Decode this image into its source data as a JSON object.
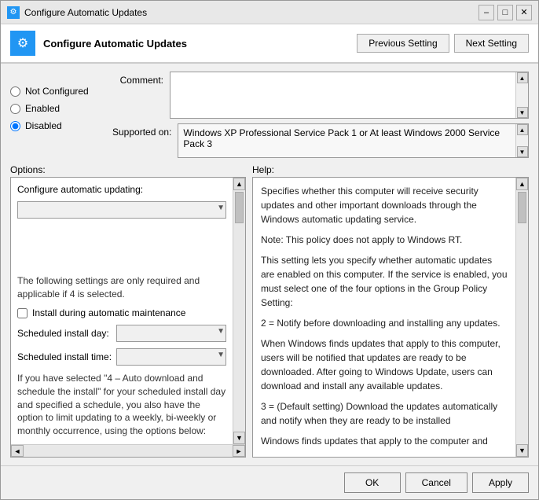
{
  "window": {
    "title": "Configure Automatic Updates",
    "icon": "⚙"
  },
  "header": {
    "title": "Configure Automatic Updates",
    "icon": "⚙",
    "prev_button": "Previous Setting",
    "next_button": "Next Setting"
  },
  "radio_group": {
    "not_configured_label": "Not Configured",
    "enabled_label": "Enabled",
    "disabled_label": "Disabled",
    "selected": "disabled"
  },
  "fields": {
    "comment_label": "Comment:",
    "supported_label": "Supported on:",
    "supported_value": "Windows XP Professional Service Pack 1 or At least Windows 2000 Service Pack 3"
  },
  "sections": {
    "options_title": "Options:",
    "help_title": "Help:"
  },
  "options": {
    "configure_label": "Configure automatic updating:",
    "dropdown_placeholder": "",
    "checkbox_label": "Install during automatic maintenance",
    "schedule_day_label": "Scheduled install day:",
    "schedule_time_label": "Scheduled install time:",
    "paragraph": "The following settings are only required and applicable if 4 is selected.",
    "bottom_paragraph": "If you have selected \"4 – Auto download and schedule the install\" for your scheduled install day and specified a schedule, you also have the option to limit updating to a weekly, bi-weekly or monthly occurrence, using the options below:"
  },
  "help": {
    "p1": "Specifies whether this computer will receive security updates and other important downloads through the Windows automatic updating service.",
    "p2": "Note: This policy does not apply to Windows RT.",
    "p3": "This setting lets you specify whether automatic updates are enabled on this computer. If the service is enabled, you must select one of the four options in the Group Policy Setting:",
    "p4": "2 = Notify before downloading and installing any updates.",
    "p5": "When Windows finds updates that apply to this computer, users will be notified that updates are ready to be downloaded. After going to Windows Update, users can download and install any available updates.",
    "p6": "3 = (Default setting) Download the updates automatically and notify when they are ready to be installed",
    "p7": "Windows finds updates that apply to the computer and"
  },
  "buttons": {
    "ok": "OK",
    "cancel": "Cancel",
    "apply": "Apply"
  }
}
